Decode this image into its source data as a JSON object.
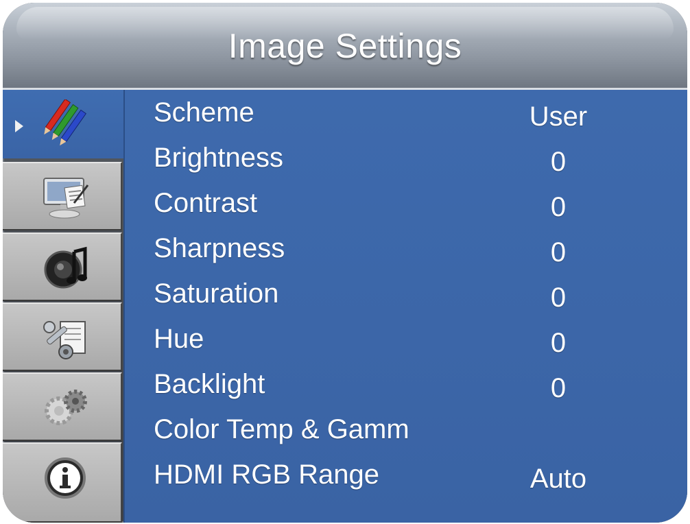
{
  "title": "Image Settings",
  "sidebar": {
    "active_index": 0,
    "tabs": [
      {
        "name": "picture",
        "icon": "color-pencils-icon"
      },
      {
        "name": "display",
        "icon": "monitor-notepad-icon"
      },
      {
        "name": "audio",
        "icon": "speaker-music-icon"
      },
      {
        "name": "tools",
        "icon": "wrench-document-icon"
      },
      {
        "name": "settings",
        "icon": "gears-icon"
      },
      {
        "name": "information",
        "icon": "info-icon"
      }
    ]
  },
  "menu": {
    "items": [
      {
        "label": "Scheme",
        "value": "User"
      },
      {
        "label": "Brightness",
        "value": "0"
      },
      {
        "label": "Contrast",
        "value": "0"
      },
      {
        "label": "Sharpness",
        "value": "0"
      },
      {
        "label": "Saturation",
        "value": "0"
      },
      {
        "label": "Hue",
        "value": "0"
      },
      {
        "label": "Backlight",
        "value": "0"
      },
      {
        "label": "Color Temp & Gamm",
        "value": ""
      },
      {
        "label": "HDMI RGB Range",
        "value": "Auto"
      }
    ]
  },
  "colors": {
    "panel": "#3d68ab",
    "header": "#9aa2ac",
    "text": "#ffffff"
  }
}
